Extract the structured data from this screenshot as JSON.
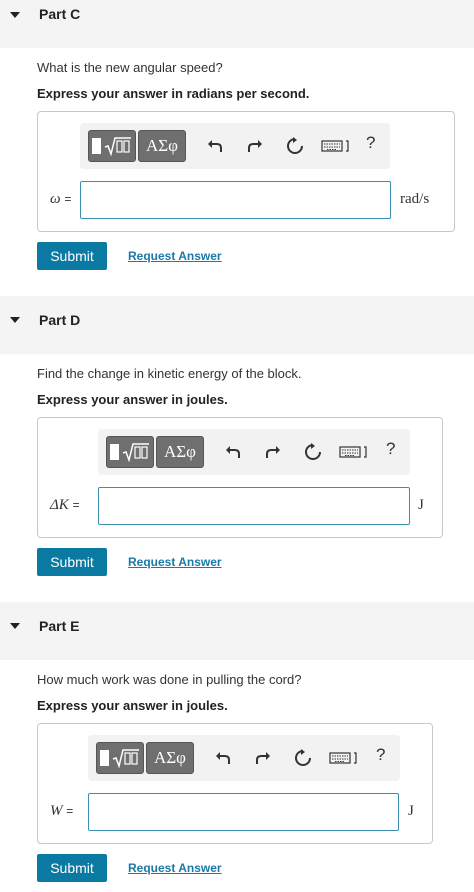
{
  "colors": {
    "accent": "#0b7aa3",
    "link": "#1a7aa8",
    "header_bg": "#f4f4f4",
    "input_border": "#3a8fb0"
  },
  "toolbar": {
    "greek_label": "ΑΣφ",
    "help_label": "?",
    "icons": [
      "templates-icon",
      "greek-symbols-icon",
      "undo-icon",
      "redo-icon",
      "reset-icon",
      "keyboard-icon",
      "help-icon"
    ]
  },
  "parts": [
    {
      "title": "Part C",
      "question": "What is the new angular speed?",
      "instruction": "Express your answer in radians per second.",
      "variable": "ω",
      "equals": "=",
      "unit": "rad/s",
      "input_value": "",
      "submit_label": "Submit",
      "request_label": "Request Answer"
    },
    {
      "title": "Part D",
      "question": "Find the change in kinetic energy of the block.",
      "instruction": "Express your answer in joules.",
      "variable": "ΔK",
      "equals": "=",
      "unit": "J",
      "input_value": "",
      "submit_label": "Submit",
      "request_label": "Request Answer"
    },
    {
      "title": "Part E",
      "question": "How much work was done in pulling the cord?",
      "instruction": "Express your answer in joules.",
      "variable": "W",
      "equals": "=",
      "unit": "J",
      "input_value": "",
      "submit_label": "Submit",
      "request_label": "Request Answer"
    }
  ]
}
